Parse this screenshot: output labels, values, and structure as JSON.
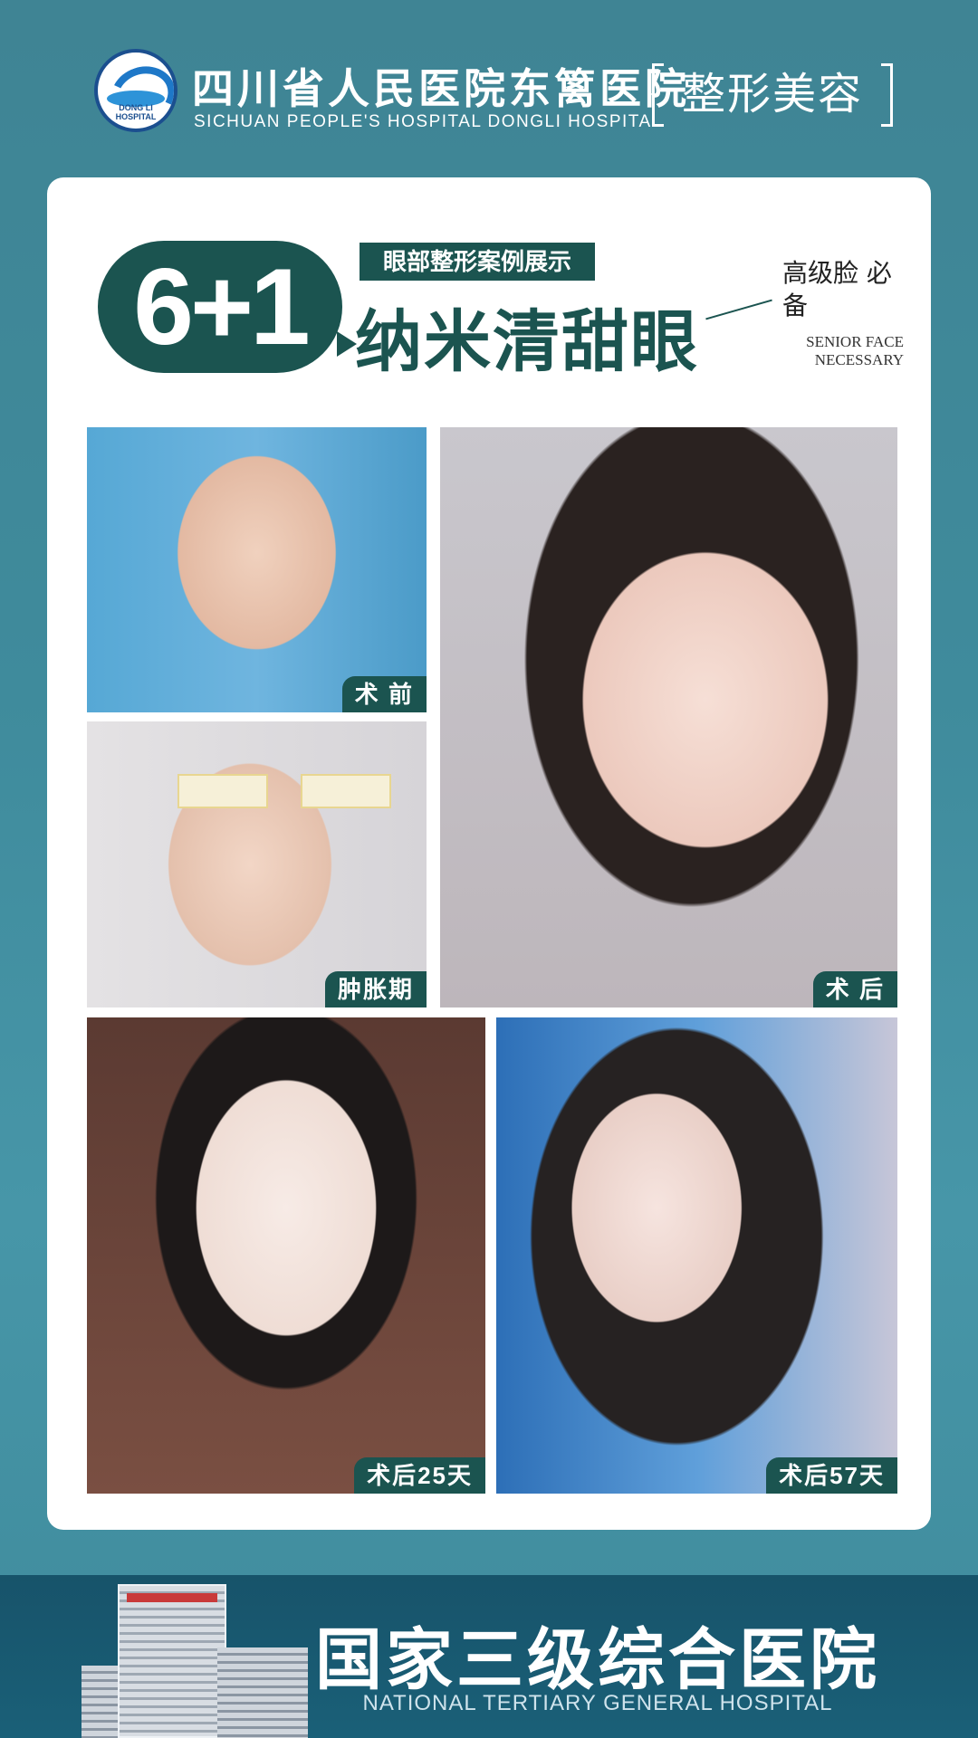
{
  "header": {
    "logo_text": "DONG LI HOSPITAL",
    "hospital_cn": "四川省人民医院东篱医院",
    "hospital_en": "SICHUAN PEOPLE'S HOSPITAL DONGLI HOSPITAL",
    "brand_tag": "整形美容"
  },
  "card": {
    "badge": "6+1",
    "subtag": "眼部整形案例展示",
    "headline": "纳米清甜眼",
    "senior_cn": "高级脸 必备",
    "senior_en": "SENIOR FACE NECESSARY"
  },
  "photos": [
    {
      "label": "术 前"
    },
    {
      "label": "肿胀期"
    },
    {
      "label": "术 后"
    },
    {
      "label": "术后25天"
    },
    {
      "label": "术后57天"
    }
  ],
  "footer": {
    "title_cn": "国家三级综合医院",
    "title_en": "NATIONAL TERTIARY GENERAL HOSPITAL"
  },
  "colors": {
    "background": "#3f8b9c",
    "accent": "#1b5450",
    "card": "#ffffff"
  }
}
